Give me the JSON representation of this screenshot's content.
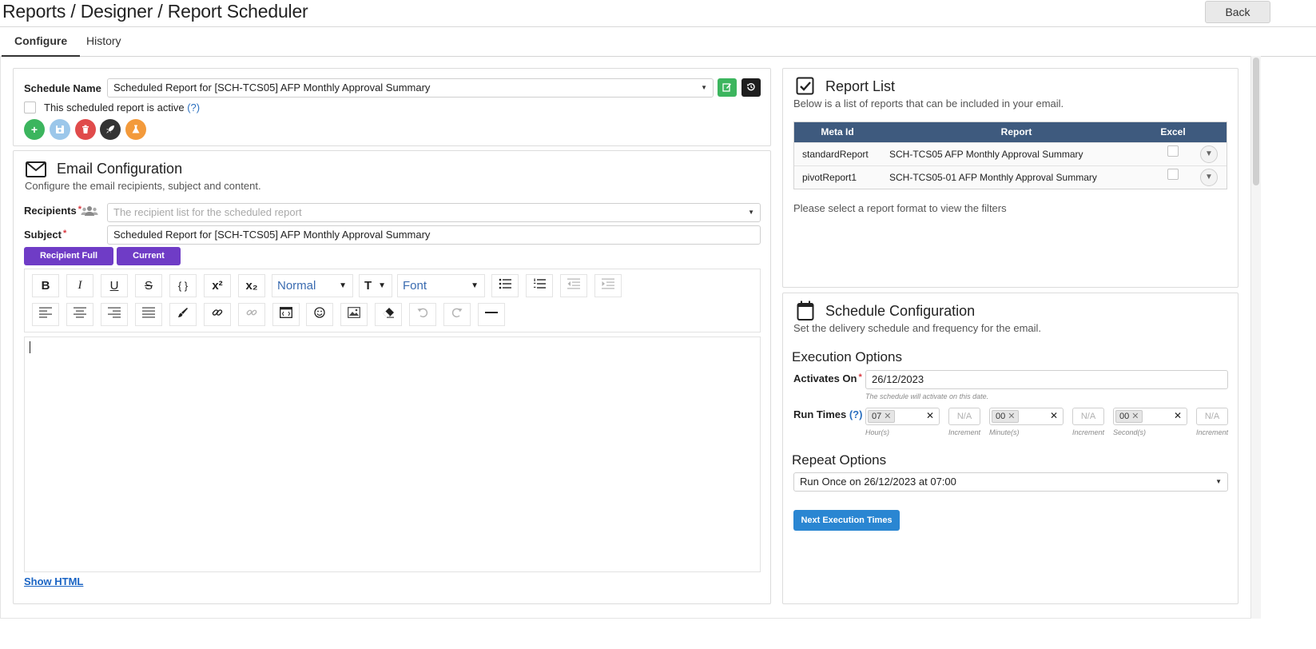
{
  "header": {
    "title": "Reports / Designer / Report Scheduler",
    "back_label": "Back"
  },
  "tabs": [
    {
      "label": "Configure"
    },
    {
      "label": "History"
    }
  ],
  "schedule": {
    "name_label": "Schedule Name",
    "name_value": "Scheduled Report for [SCH-TCS05] AFP Monthly Approval Summary",
    "active_label": "This scheduled report is active",
    "help_label": "(?)",
    "active_checked": false
  },
  "email": {
    "title": "Email Configuration",
    "description": "Configure the email recipients, subject and content.",
    "recipients_label": "Recipients",
    "recipients_placeholder": "The recipient list for the scheduled report",
    "subject_label": "Subject",
    "subject_value": "Scheduled Report for [SCH-TCS05] AFP Monthly Approval Summary",
    "required_mark": "*",
    "tokens": [
      "Recipient Full Name",
      "Current Date"
    ],
    "show_html_label": "Show HTML"
  },
  "toolbar": {
    "paragraph_format": "Normal",
    "font": "Font"
  },
  "report_list": {
    "title": "Report List",
    "description": "Below is a list of reports that can be included in your email.",
    "columns": [
      "Meta Id",
      "Report",
      "Excel"
    ],
    "rows": [
      {
        "meta_id": "standardReport",
        "report": "SCH-TCS05 AFP Monthly Approval Summary",
        "excel": false
      },
      {
        "meta_id": "pivotReport1",
        "report": "SCH-TCS05-01 AFP Monthly Approval Summary",
        "excel": false
      }
    ],
    "note": "Please select a report format to view the filters"
  },
  "schedule_config": {
    "title": "Schedule Configuration",
    "description": "Set the delivery schedule and frequency for the email.",
    "execution_title": "Execution Options",
    "activates_label": "Activates On",
    "activates_value": "26/12/2023",
    "activates_hint": "The schedule will activate on this date.",
    "run_times_label": "Run Times",
    "hour_value": "07",
    "minute_value": "00",
    "second_value": "00",
    "na_label": "N/A",
    "hour_hint": "Hour(s)",
    "minute_hint": "Minute(s)",
    "second_hint": "Second(s)",
    "increment_hint": "Increment",
    "repeat_title": "Repeat Options",
    "repeat_value": "Run Once on 26/12/2023 at 07:00",
    "next_button": "Next Execution Times"
  },
  "colors": {
    "accent_purple": "#6f3cc6",
    "table_header": "#3e5a7e",
    "primary_blue": "#2a86d2",
    "add_green": "#3cb55e",
    "delete_red": "#e04b4b",
    "flask_orange": "#f39a3b"
  }
}
